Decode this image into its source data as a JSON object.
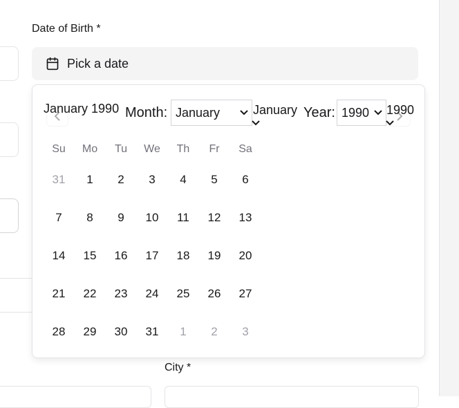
{
  "form": {
    "dob_label": "Date of Birth *",
    "city_label": "City *",
    "date_button_text": "Pick a date"
  },
  "calendar": {
    "caption": "January 1990",
    "month_label": "Month:",
    "month_selected": "January",
    "month_caption": "January",
    "year_label": "Year:",
    "year_selected": "1990",
    "year_caption": "1990",
    "weekdays": [
      "Su",
      "Mo",
      "Tu",
      "We",
      "Th",
      "Fr",
      "Sa"
    ],
    "weeks": [
      [
        {
          "d": "31",
          "muted": true
        },
        {
          "d": "1"
        },
        {
          "d": "2"
        },
        {
          "d": "3"
        },
        {
          "d": "4"
        },
        {
          "d": "5"
        },
        {
          "d": "6"
        }
      ],
      [
        {
          "d": "7"
        },
        {
          "d": "8"
        },
        {
          "d": "9"
        },
        {
          "d": "10"
        },
        {
          "d": "11"
        },
        {
          "d": "12"
        },
        {
          "d": "13"
        }
      ],
      [
        {
          "d": "14"
        },
        {
          "d": "15"
        },
        {
          "d": "16"
        },
        {
          "d": "17"
        },
        {
          "d": "18"
        },
        {
          "d": "19"
        },
        {
          "d": "20"
        }
      ],
      [
        {
          "d": "21"
        },
        {
          "d": "22"
        },
        {
          "d": "23"
        },
        {
          "d": "24"
        },
        {
          "d": "25"
        },
        {
          "d": "26"
        },
        {
          "d": "27"
        }
      ],
      [
        {
          "d": "28"
        },
        {
          "d": "29"
        },
        {
          "d": "30"
        },
        {
          "d": "31"
        },
        {
          "d": "1",
          "muted": true
        },
        {
          "d": "2",
          "muted": true
        },
        {
          "d": "3",
          "muted": true
        }
      ]
    ]
  },
  "icons": {
    "date_button": "calendar-icon",
    "prev": "chevron-left-icon",
    "next": "chevron-right-icon",
    "select": "chevron-down-icon"
  }
}
